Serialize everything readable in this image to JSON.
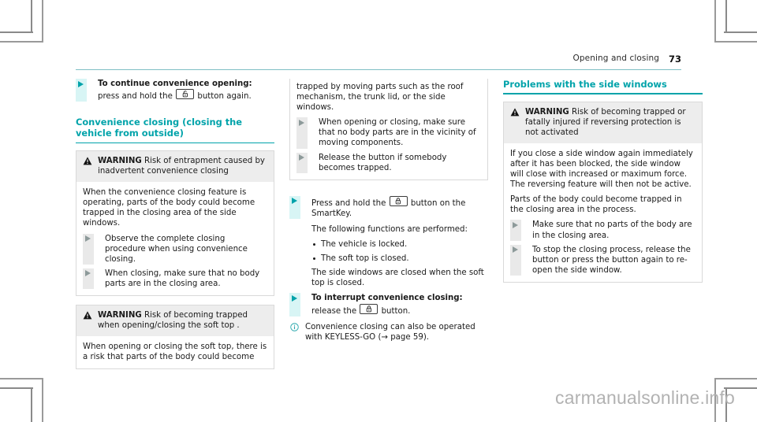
{
  "runhead": {
    "title": "Opening and closing",
    "page": "73"
  },
  "column1": {
    "step_continue": {
      "bold": "To continue convenience opening:",
      "rest_before_key": " press and hold the ",
      "key_icon": "unlock-button-icon",
      "rest_after_key": " button again."
    },
    "section_heading": "Convenience closing (closing the vehicle from outside)",
    "warning1": {
      "label": "WARNING",
      "title": " Risk of entrapment caused by inadvertent convenience closing",
      "body": "When the convenience closing feature is operating, parts of the body could become trapped in the closing area of the side windows.",
      "steps": [
        "Observe the complete closing procedure when using convenience closing.",
        "When closing, make sure that no body parts are in the closing area."
      ]
    },
    "warning2": {
      "label": "WARNING",
      "title": " Risk of becoming trapped when opening/closing the soft top .",
      "body": "When opening or closing the soft top, there is a risk that parts of the body could become"
    }
  },
  "column2": {
    "warning2_cont": {
      "body": "trapped by moving parts such as the roof mechanism, the trunk lid, or the side windows.",
      "steps": [
        "When opening or closing, make sure that no body parts are in the vicinity of moving components.",
        "Release the button if somebody becomes trapped."
      ]
    },
    "step_press": {
      "before_key": "Press and hold the ",
      "key_icon": "lock-button-icon",
      "after_key": " button on the SmartKey."
    },
    "functions_intro": "The following functions are performed:",
    "bullets": [
      "The vehicle is locked.",
      "The soft top is closed."
    ],
    "bullets_note": "The side windows are closed when the soft top is closed.",
    "step_interrupt": {
      "bold": "To interrupt convenience closing:",
      "rest_before_key": " release the ",
      "key_icon": "lock-button-icon",
      "rest_after_key": " button."
    },
    "note": "Convenience closing can also be operated with KEYLESS-GO (→ page 59)."
  },
  "column3": {
    "section_heading": "Problems with the side windows",
    "warning": {
      "label": "WARNING",
      "title": " Risk of becoming trapped or fatally injured if reversing protection is not activated",
      "body1": "If you close a side window again immediately after it has been blocked, the side window will close with increased or maximum force. The reversing feature will then not be active.",
      "body2": "Parts of the body could become trapped in the closing area in the process.",
      "steps": [
        "Make sure that no parts of the body are in the closing area.",
        "To stop the closing process, release the button or press the button again to re-open the side window."
      ]
    }
  },
  "watermark": "carmanualsonline.info",
  "colors": {
    "accent_teal": "#00a3aa",
    "step_marker_bg": "#d8f5f5",
    "warn_head_bg": "#ededed",
    "rule_teal": "#7fbfc4",
    "watermark_gray": "#b2b2b2"
  }
}
